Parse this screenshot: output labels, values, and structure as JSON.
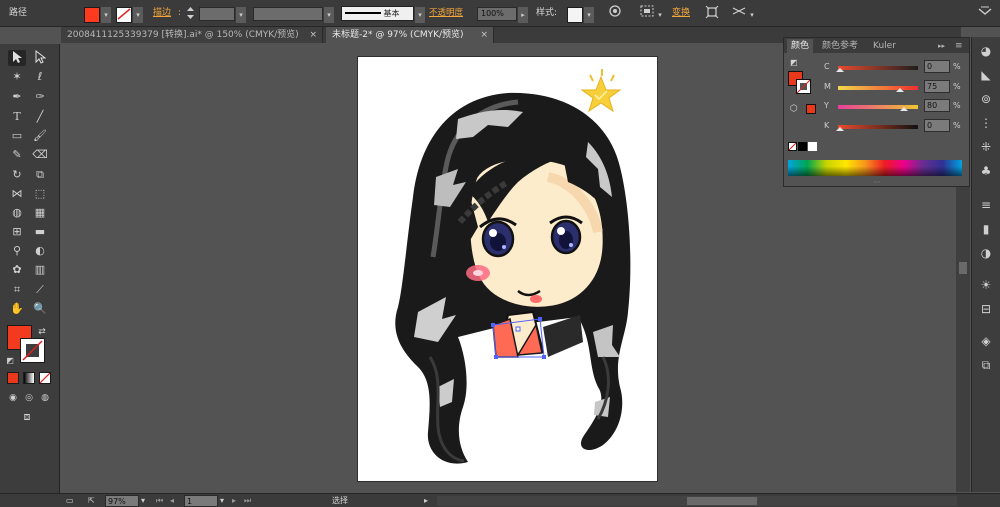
{
  "control_bar": {
    "object_label": "路径",
    "fill_color": "#ff3b1f",
    "stroke_label": "描边",
    "stroke_unit_symbol": ":",
    "brush_preset": "基本",
    "opacity_label": "不透明度",
    "opacity_value": "100%",
    "style_label": "样式",
    "style_colon": ":",
    "transform_label": "变换"
  },
  "tabs": [
    {
      "label": "2008411125339379 [转换].ai* @ 150% (CMYK/预览)",
      "close": "×",
      "active": false
    },
    {
      "label": "未标题-2* @ 97% (CMYK/预览)",
      "close": "×",
      "active": true
    }
  ],
  "toolbox": {
    "fill_swatch_color": "#f23a1f",
    "stroke_swatch_color": "#ffffff"
  },
  "color_panel": {
    "tabs": [
      "颜色",
      "颜色参考",
      "Kuler"
    ],
    "expand_glyph": "▸▸",
    "menu_glyph": "≡",
    "fill_color": "#e8391d",
    "channels": [
      {
        "name": "C",
        "value": "0",
        "unit": "%"
      },
      {
        "name": "M",
        "value": "75",
        "unit": "%"
      },
      {
        "name": "Y",
        "value": "80",
        "unit": "%"
      },
      {
        "name": "K",
        "value": "0",
        "unit": "%"
      }
    ]
  },
  "status_bar": {
    "zoom": "97%",
    "page": "1",
    "status_text": "选择"
  },
  "colors": {
    "app_bg": "#535353",
    "panel_bg": "#3b3b3b",
    "accent_orange": "#f5a53c",
    "artboard": "#ffffff"
  }
}
